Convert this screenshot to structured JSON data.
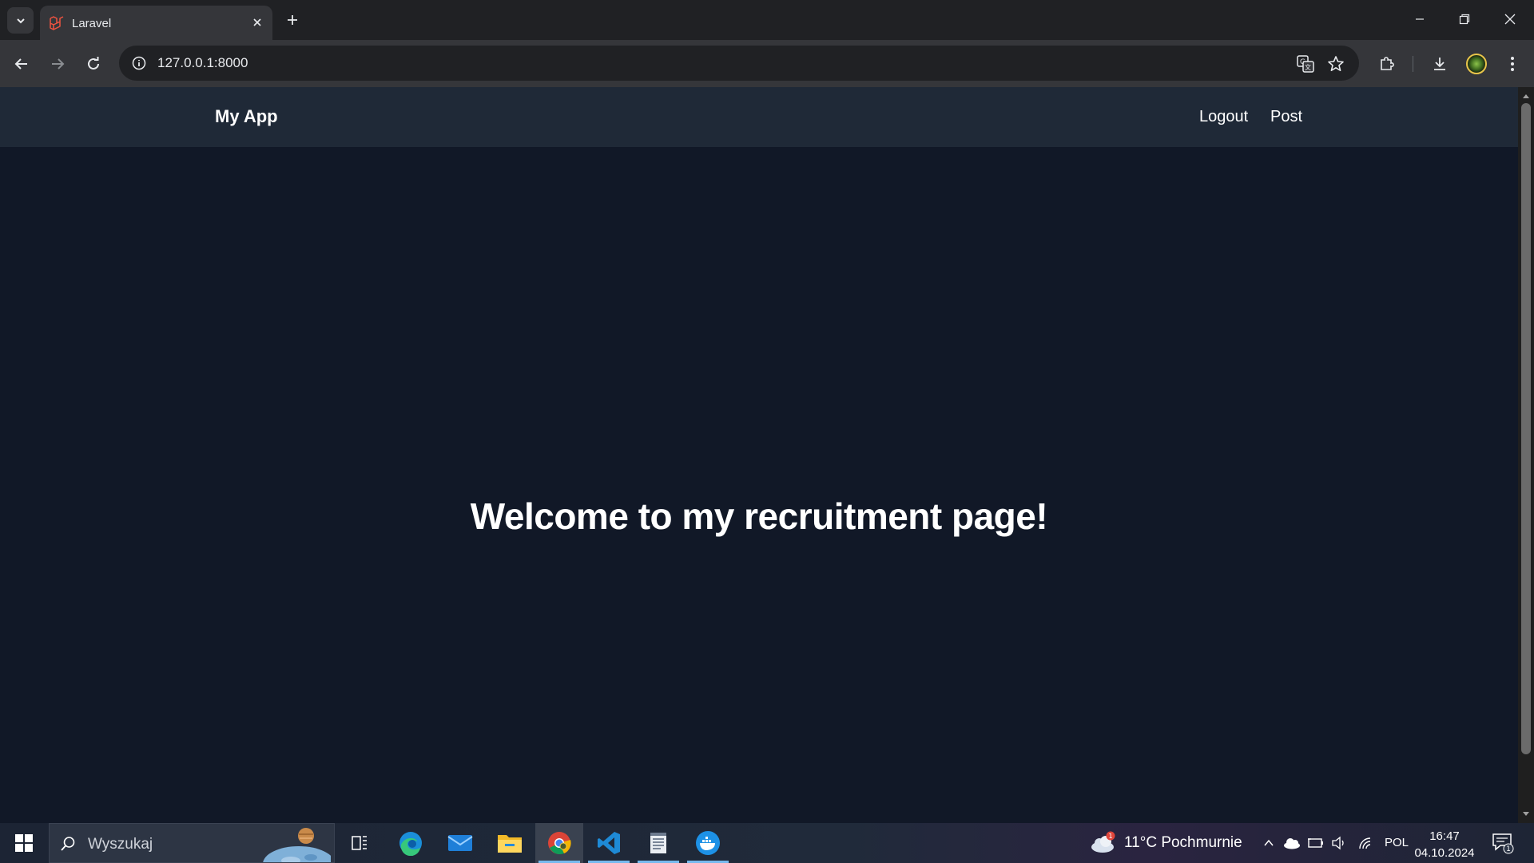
{
  "browser": {
    "tab_title": "Laravel",
    "url": "127.0.0.1:8000",
    "favicon": "laravel-icon"
  },
  "page": {
    "brand": "My App",
    "nav_links": [
      "Logout",
      "Post"
    ],
    "heading": "Welcome to my recruitment page!",
    "background_color": "#111827",
    "navbar_color": "#1f2937"
  },
  "taskbar": {
    "search_placeholder": "Wyszukaj",
    "pinned_apps": [
      "task-view-icon",
      "edge-icon",
      "mail-icon",
      "file-explorer-icon",
      "chrome-icon",
      "vscode-icon",
      "notepad-icon",
      "docker-icon"
    ],
    "active_app": "chrome-icon",
    "weather": "11°C  Pochmurnie",
    "weather_badge": "1",
    "language": "POL",
    "time": "16:47",
    "date": "04.10.2024",
    "notification_count": "1"
  }
}
